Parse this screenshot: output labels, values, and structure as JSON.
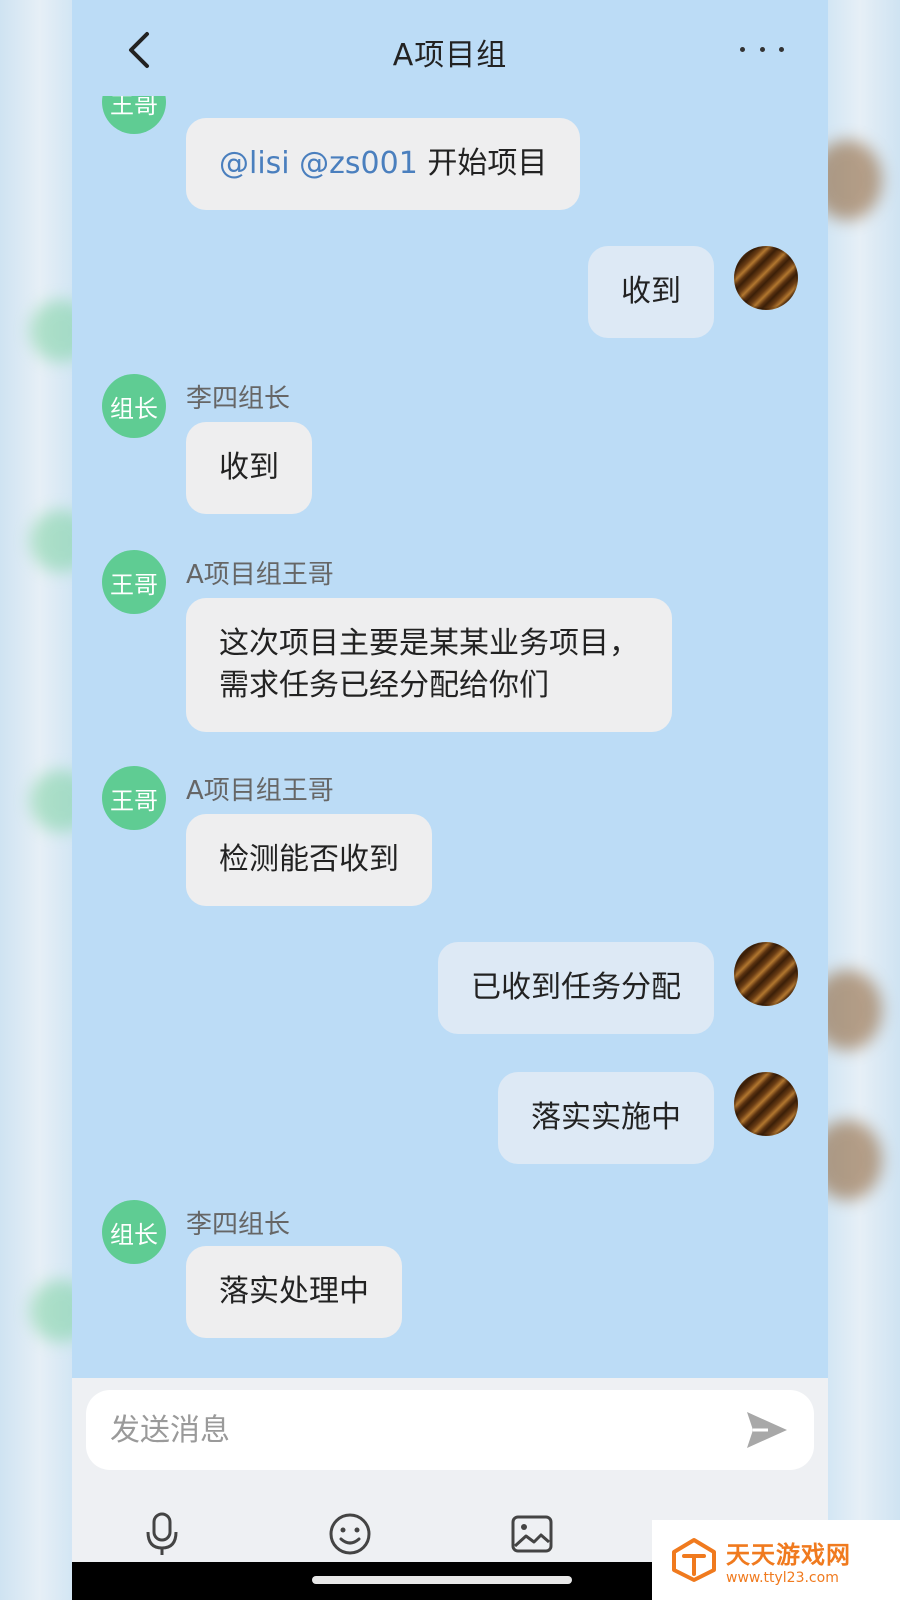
{
  "header": {
    "title": "A项目组"
  },
  "messages": [
    {
      "sender": "",
      "avatar_text": "王哥",
      "text_mentions": "@lisi @zs001",
      "text": " 开始项目"
    },
    {
      "text": "收到"
    },
    {
      "sender": "李四组长",
      "avatar_text": "组长",
      "text": "收到"
    },
    {
      "sender": "A项目组王哥",
      "avatar_text": "王哥",
      "text_line1": "这次项目主要是某某业务项目，",
      "text_line2": "需求任务已经分配给你们"
    },
    {
      "sender": "A项目组王哥",
      "avatar_text": "王哥",
      "text": "检测能否收到"
    },
    {
      "text": "已收到任务分配"
    },
    {
      "text": "落实实施中"
    },
    {
      "sender": "李四组长",
      "avatar_text": "组长",
      "text": "落实处理中"
    }
  ],
  "input": {
    "placeholder": "发送消息"
  },
  "toolbar": {
    "icons": [
      "microphone-icon",
      "emoji-icon",
      "image-icon",
      "close-icon"
    ]
  },
  "watermark": {
    "name": "天天游戏网",
    "url": "www.ttyl23.com"
  },
  "colors": {
    "chat_background": "#bcdcf6",
    "incoming_bubble": "#eeeeef",
    "outgoing_bubble": "#dde9f5",
    "avatar_green": "#5fcc93",
    "mention": "#4a7fbe",
    "watermark": "#f07a1e"
  }
}
